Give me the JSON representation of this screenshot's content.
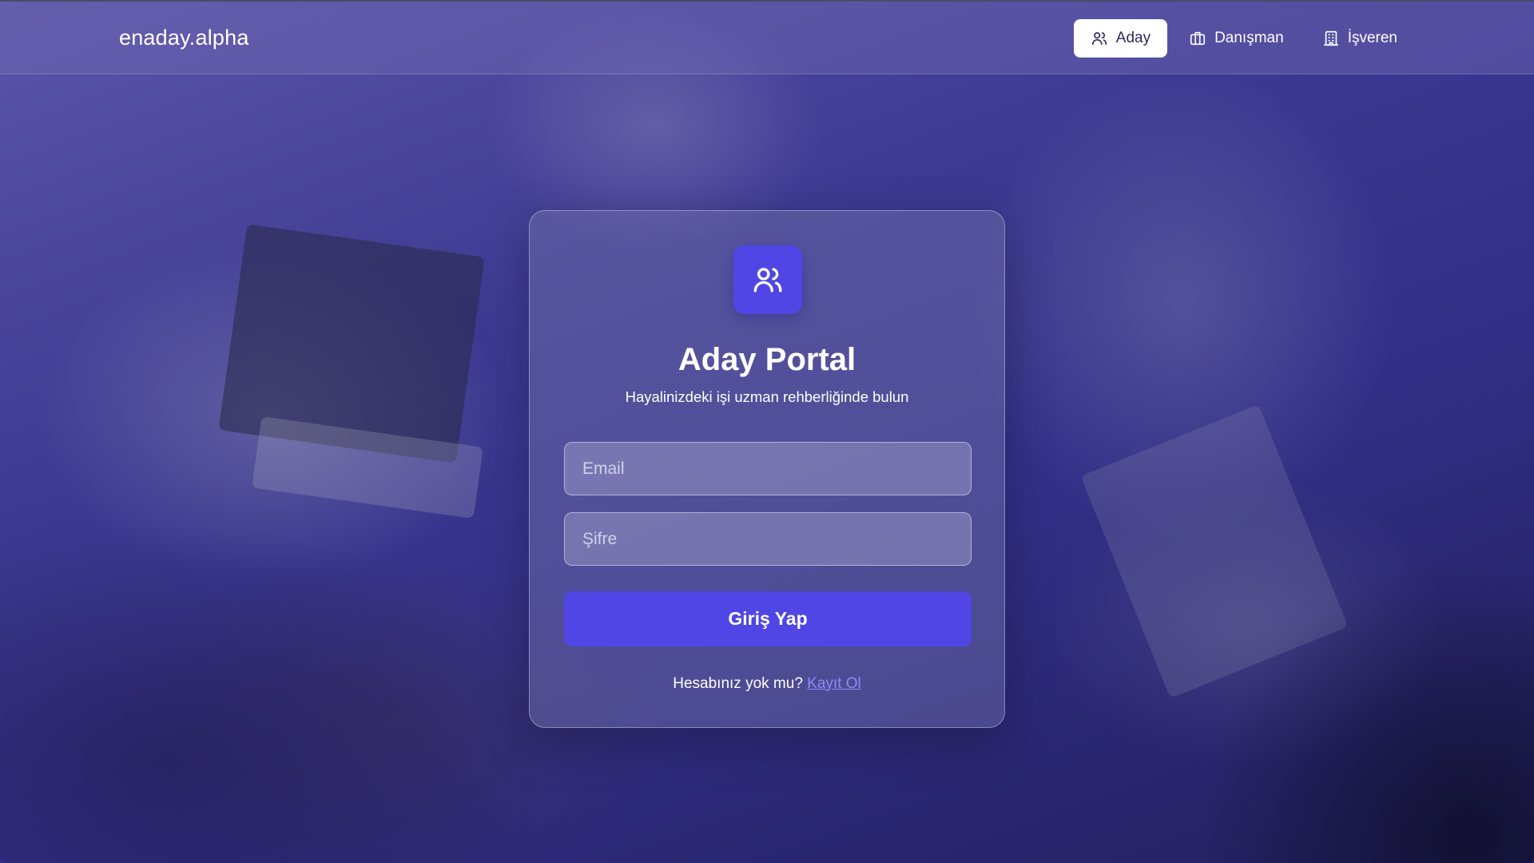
{
  "header": {
    "brand": "enaday.alpha",
    "nav": [
      {
        "label": "Aday",
        "icon": "users-icon",
        "active": true
      },
      {
        "label": "Danışman",
        "icon": "briefcase-icon",
        "active": false
      },
      {
        "label": "İşveren",
        "icon": "building-icon",
        "active": false
      }
    ]
  },
  "login": {
    "icon": "users-icon",
    "title": "Aday Portal",
    "subtitle": "Hayalinizdeki işi uzman rehberliğinde bulun",
    "email": {
      "value": "",
      "placeholder": "Email"
    },
    "password": {
      "value": "",
      "placeholder": "Şifre"
    },
    "submit_label": "Giriş Yap",
    "register_prompt": "Hesabınız yok mu?",
    "register_link": "Kayıt Ol"
  },
  "colors": {
    "accent": "#4f46e5",
    "link": "#8b8cf8"
  }
}
